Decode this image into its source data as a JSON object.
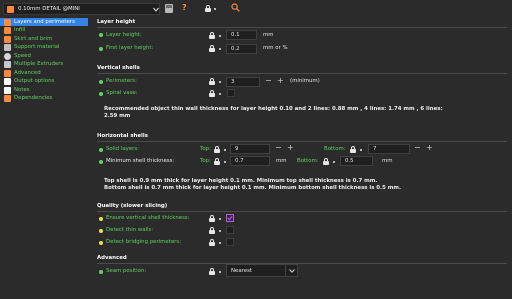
{
  "colors": {
    "background": "#2b2b2b",
    "green": "#5fd35f",
    "yellow": "#f0e04a",
    "orange": "#ff8a3d",
    "accent": "#b45bd8"
  },
  "toolbar": {
    "preset": "0.10mm DETAIL @MINI",
    "preset_icon": "printer-profile-icon",
    "dropdown_icon": "chevron-down-icon",
    "save_icon": "save-icon",
    "help_icon": "question-icon",
    "lock_icon": "lock-icon",
    "search_icon": "search-icon"
  },
  "sidebar": {
    "items": [
      {
        "label": "Layers and perimeters",
        "selected": true
      },
      {
        "label": "Infill"
      },
      {
        "label": "Skirt and brim"
      },
      {
        "label": "Support material"
      },
      {
        "label": "Speed"
      },
      {
        "label": "Multiple Extruders"
      },
      {
        "label": "Advanced"
      },
      {
        "label": "Output options"
      },
      {
        "label": "Notes"
      },
      {
        "label": "Dependencies"
      }
    ]
  },
  "layer_height": {
    "title": "Layer height",
    "layer_height_label": "Layer height:",
    "layer_height_value": "0.1",
    "layer_height_unit": "mm",
    "first_layer_label": "First layer height:",
    "first_layer_value": "0.2",
    "first_layer_unit": "mm or %"
  },
  "vertical_shells": {
    "title": "Vertical shells",
    "perimeters_label": "Perimeters:",
    "perimeters_value": "3",
    "perimeters_note": "(minimum)",
    "spiral_label": "Spiral vase:",
    "recommendation_line1": "Recommended object thin wall thickness for layer height 0.10 and 2 lines: 0.88 mm , 4 lines: 1.74 mm , 6 lines:",
    "recommendation_line2": "2.59 mm"
  },
  "horizontal_shells": {
    "title": "Horizontal shells",
    "solid_layers_label": "Solid layers:",
    "top_label": "Top:",
    "top_value": "9",
    "bottom_label": "Bottom:",
    "bottom_value": "7",
    "min_shell_label": "Minimum shell thickness:",
    "min_top_value": "0.7",
    "min_top_unit": "mm",
    "min_bottom_value": "0.5",
    "min_bottom_unit": "mm",
    "info_line1": "Top shell is 0.9 mm thick for layer height 0.1 mm. Minimum top shell thickness is 0.7 mm.",
    "info_line2": "Bottom shell is 0.7 mm thick for layer height 0.1 mm. Minimum bottom shell thickness is 0.5 mm."
  },
  "quality": {
    "title": "Quality (slower slicing)",
    "ensure_label": "Ensure vertical shell thickness:",
    "ensure_checked": true,
    "thin_walls_label": "Detect thin walls:",
    "thin_walls_checked": false,
    "bridging_label": "Detect bridging perimeters:",
    "bridging_checked": false
  },
  "advanced": {
    "title": "Advanced",
    "seam_label": "Seam position:",
    "seam_value": "Nearest"
  }
}
